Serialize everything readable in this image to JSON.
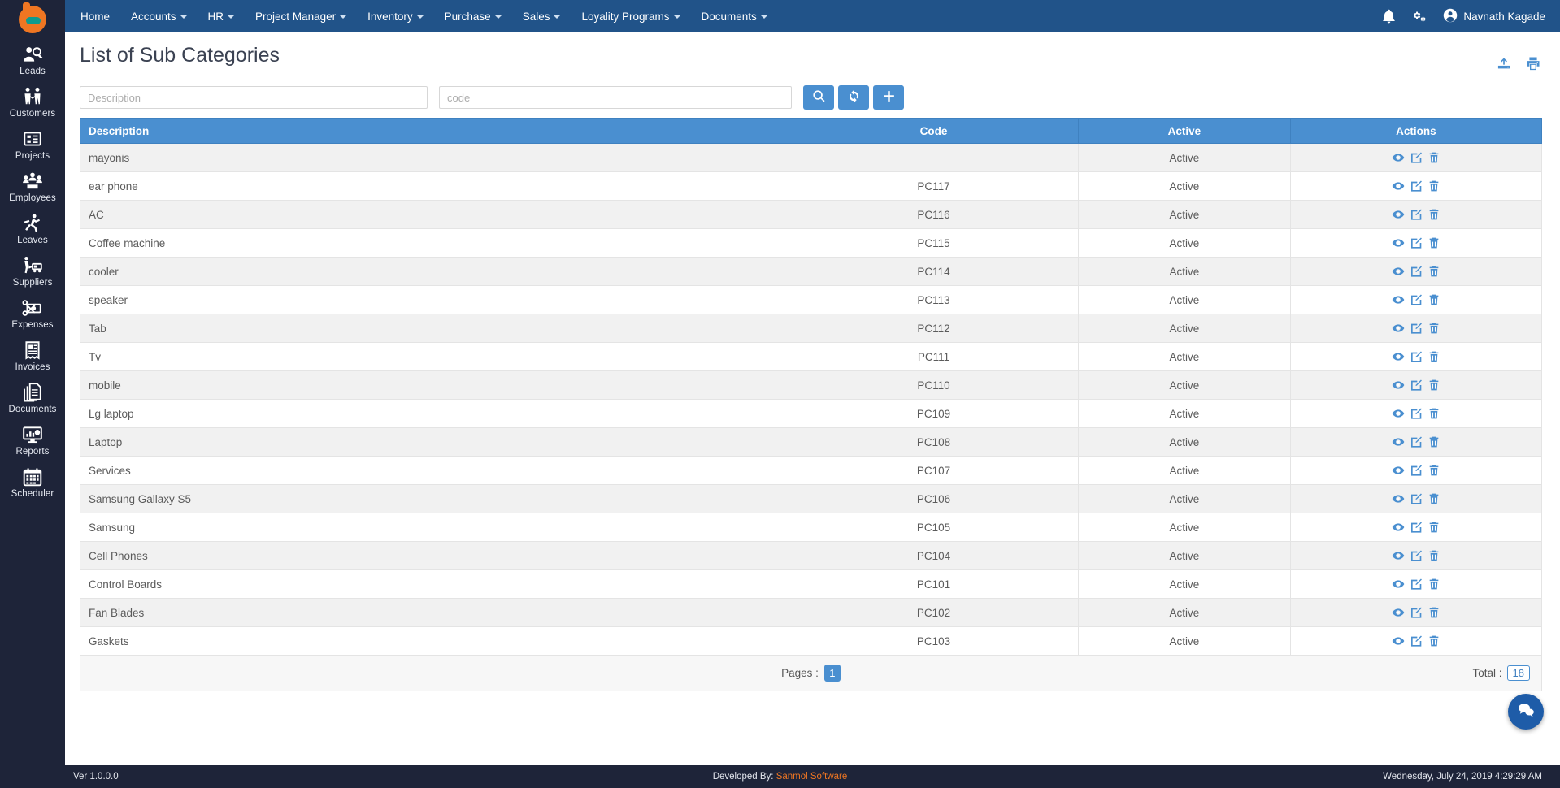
{
  "brand": {
    "logo_icon": "bee-logo-icon"
  },
  "sidebar": {
    "items": [
      {
        "label": "Leads",
        "icon": "leads-icon"
      },
      {
        "label": "Customers",
        "icon": "customers-icon"
      },
      {
        "label": "Projects",
        "icon": "projects-icon"
      },
      {
        "label": "Employees",
        "icon": "employees-icon"
      },
      {
        "label": "Leaves",
        "icon": "leaves-icon"
      },
      {
        "label": "Suppliers",
        "icon": "suppliers-icon"
      },
      {
        "label": "Expenses",
        "icon": "expenses-icon"
      },
      {
        "label": "Invoices",
        "icon": "invoices-icon"
      },
      {
        "label": "Documents",
        "icon": "documents-icon"
      },
      {
        "label": "Reports",
        "icon": "reports-icon"
      },
      {
        "label": "Scheduler",
        "icon": "scheduler-icon"
      }
    ]
  },
  "topnav": {
    "items": [
      {
        "label": "Home",
        "has_caret": false
      },
      {
        "label": "Accounts",
        "has_caret": true
      },
      {
        "label": "HR",
        "has_caret": true
      },
      {
        "label": "Project Manager",
        "has_caret": true
      },
      {
        "label": "Inventory",
        "has_caret": true
      },
      {
        "label": "Purchase",
        "has_caret": true
      },
      {
        "label": "Sales",
        "has_caret": true
      },
      {
        "label": "Loyality Programs",
        "has_caret": true
      },
      {
        "label": "Documents",
        "has_caret": true
      }
    ],
    "notification_icon": "bell-icon",
    "settings_icon": "gears-icon",
    "user_icon": "user-avatar-icon",
    "user_name": "Navnath Kagade"
  },
  "page": {
    "title": "List of Sub Categories",
    "export_icon": "upload-icon",
    "print_icon": "print-icon"
  },
  "filters": {
    "description_placeholder": "Description",
    "description_value": "",
    "code_placeholder": "code",
    "code_value": "",
    "search_icon": "search-icon",
    "refresh_icon": "refresh-icon",
    "add_icon": "plus-icon"
  },
  "table": {
    "columns": [
      "Description",
      "Code",
      "Active",
      "Actions"
    ],
    "row_action_icons": [
      "eye-icon",
      "edit-icon",
      "trash-icon"
    ],
    "rows": [
      {
        "description": "mayonis",
        "code": "",
        "active": "Active"
      },
      {
        "description": "ear phone",
        "code": "PC117",
        "active": "Active"
      },
      {
        "description": "AC",
        "code": "PC116",
        "active": "Active"
      },
      {
        "description": "Coffee machine",
        "code": "PC115",
        "active": "Active"
      },
      {
        "description": "cooler",
        "code": "PC114",
        "active": "Active"
      },
      {
        "description": "speaker",
        "code": "PC113",
        "active": "Active"
      },
      {
        "description": "Tab",
        "code": "PC112",
        "active": "Active"
      },
      {
        "description": "Tv",
        "code": "PC111",
        "active": "Active"
      },
      {
        "description": "mobile",
        "code": "PC110",
        "active": "Active"
      },
      {
        "description": "Lg laptop",
        "code": "PC109",
        "active": "Active"
      },
      {
        "description": "Laptop",
        "code": "PC108",
        "active": "Active"
      },
      {
        "description": "Services",
        "code": "PC107",
        "active": "Active"
      },
      {
        "description": "Samsung Gallaxy S5",
        "code": "PC106",
        "active": "Active"
      },
      {
        "description": "Samsung",
        "code": "PC105",
        "active": "Active"
      },
      {
        "description": "Cell Phones",
        "code": "PC104",
        "active": "Active"
      },
      {
        "description": "Control Boards",
        "code": "PC101",
        "active": "Active"
      },
      {
        "description": "Fan Blades",
        "code": "PC102",
        "active": "Active"
      },
      {
        "description": "Gaskets",
        "code": "PC103",
        "active": "Active"
      }
    ]
  },
  "pager": {
    "pages_label": "Pages :",
    "current_page": "1",
    "total_label": "Total :",
    "total_value": "18"
  },
  "chat": {
    "icon": "chat-bubble-icon"
  },
  "footer": {
    "version": "Ver 1.0.0.0",
    "developed_by_label": "Developed By:",
    "developer": "Sanmol Software",
    "datetime": "Wednesday, July 24, 2019 4:29:29 AM"
  },
  "colors": {
    "sidebar_bg": "#1e2439",
    "topnav_bg": "#215389",
    "accent_blue": "#4a8fd0",
    "brand_orange": "#ef7622"
  }
}
